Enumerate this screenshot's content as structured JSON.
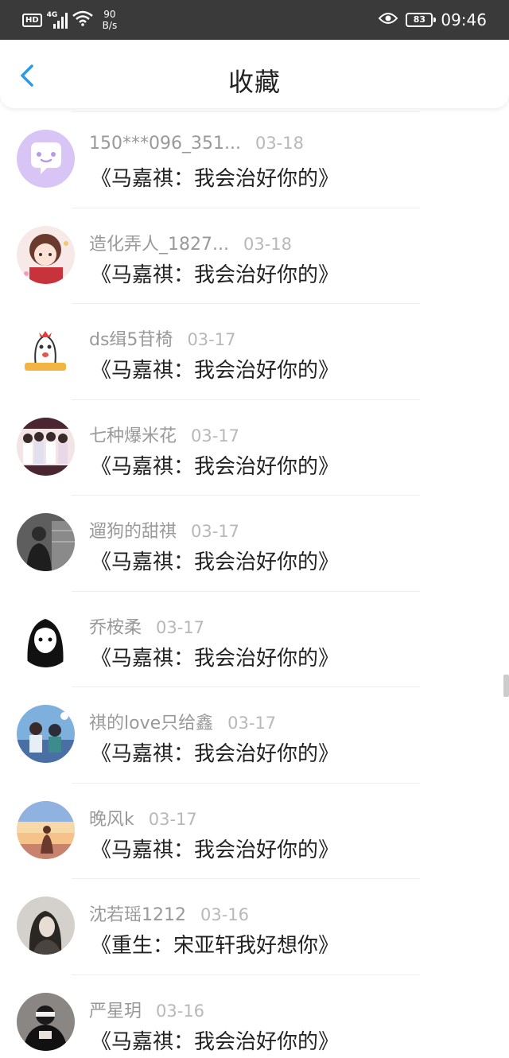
{
  "status_bar": {
    "hd": "HD",
    "network": "4G",
    "speed_value": "90",
    "speed_unit": "B/s",
    "battery": "83",
    "time": "09:46"
  },
  "header": {
    "title": "收藏",
    "back_icon": "chevron-left-icon",
    "accent": "#2b9ae8"
  },
  "items": [
    {
      "user": "150***096_351...",
      "date": "03-18",
      "title": "《马嘉祺：我会治好你的》",
      "avatar": "chat-bubble-avatar"
    },
    {
      "user": "造化弄人_1827...",
      "date": "03-18",
      "title": "《马嘉祺：我会治好你的》",
      "avatar": "anime-girl-avatar"
    },
    {
      "user": "ds缉5苷椅",
      "date": "03-17",
      "title": "《马嘉祺：我会治好你的》",
      "avatar": "cartoon-ghost-avatar"
    },
    {
      "user": "七种爆米花",
      "date": "03-17",
      "title": "《马嘉祺：我会治好你的》",
      "avatar": "group-photo-avatar"
    },
    {
      "user": "遛狗的甜祺",
      "date": "03-17",
      "title": "《马嘉祺：我会治好你的》",
      "avatar": "person-photo-avatar"
    },
    {
      "user": "乔桉柔",
      "date": "03-17",
      "title": "《马嘉祺：我会治好你的》",
      "avatar": "manga-girl-avatar"
    },
    {
      "user": "祺的love只给鑫",
      "date": "03-17",
      "title": "《马嘉祺：我会治好你的》",
      "avatar": "anime-scene-avatar"
    },
    {
      "user": "晚风k",
      "date": "03-17",
      "title": "《马嘉祺：我会治好你的》",
      "avatar": "sunset-girl-avatar"
    },
    {
      "user": "沈若瑶1212",
      "date": "03-16",
      "title": "《重生：宋亚轩我好想你》",
      "avatar": "girl-photo-avatar"
    },
    {
      "user": "严星玥",
      "date": "03-16",
      "title": "《马嘉祺：我会治好你的》",
      "avatar": "dark-portrait-avatar"
    }
  ]
}
